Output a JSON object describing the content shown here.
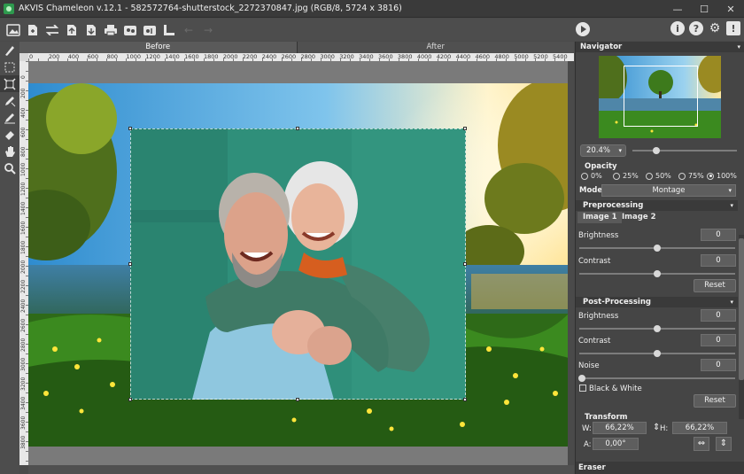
{
  "window": {
    "title": "AKVIS Chameleon v.12.1 - 582572764-shutterstock_2272370847.jpg (RGB/8, 5724 x 3816)",
    "controls": [
      "—",
      "☐",
      "✕"
    ]
  },
  "toolbar": {
    "icons": [
      "open-image-icon",
      "save-icon",
      "swap-icon",
      "load-fg-icon",
      "load-bg-icon",
      "print-icon",
      "presets-icon",
      "presets-save-icon",
      "ruler-icon",
      "undo-icon",
      "redo-icon"
    ],
    "right_icons": [
      "i",
      "?",
      "⚙",
      "!"
    ]
  },
  "view_tabs": {
    "before": "Before",
    "after": "After"
  },
  "ruler": {
    "h_marks": [
      "0",
      "200",
      "400",
      "600",
      "800",
      "1000",
      "1200",
      "1400",
      "1600",
      "1800",
      "2000",
      "2200",
      "2400",
      "2600",
      "2800",
      "3000",
      "3200",
      "3400",
      "3600",
      "3800",
      "4000",
      "4200",
      "4400",
      "4600",
      "4800",
      "5000",
      "5200",
      "5400"
    ],
    "v_marks": [
      "0",
      "200",
      "400",
      "600",
      "800",
      "1000",
      "1200",
      "1400",
      "1600",
      "1800",
      "2000",
      "2200",
      "2400",
      "2600",
      "2800",
      "3000",
      "3200",
      "3400",
      "3600",
      "3800"
    ]
  },
  "navigator": {
    "title": "Navigator",
    "zoom": "20.4%"
  },
  "opacity": {
    "title": "Opacity",
    "options": [
      "0%",
      "25%",
      "50%",
      "75%",
      "100%"
    ],
    "selected_index": 4
  },
  "mode": {
    "label": "Mode",
    "value": "Montage"
  },
  "preprocessing": {
    "title": "Preprocessing",
    "tabs": [
      "Image 1",
      "Image 2"
    ],
    "brightness_label": "Brightness",
    "brightness_value": "0",
    "contrast_label": "Contrast",
    "contrast_value": "0",
    "reset": "Reset"
  },
  "postprocessing": {
    "title": "Post-Processing",
    "brightness_label": "Brightness",
    "brightness_value": "0",
    "contrast_label": "Contrast",
    "contrast_value": "0",
    "noise_label": "Noise",
    "noise_value": "0",
    "bw_label": "Black & White",
    "reset": "Reset"
  },
  "transform": {
    "title": "Transform",
    "w_label": "W:",
    "w_value": "66,22%",
    "h_label": "H:",
    "h_value": "66,22%",
    "a_label": "A:",
    "a_value": "0,00°"
  },
  "eraser": {
    "title": "Eraser"
  }
}
